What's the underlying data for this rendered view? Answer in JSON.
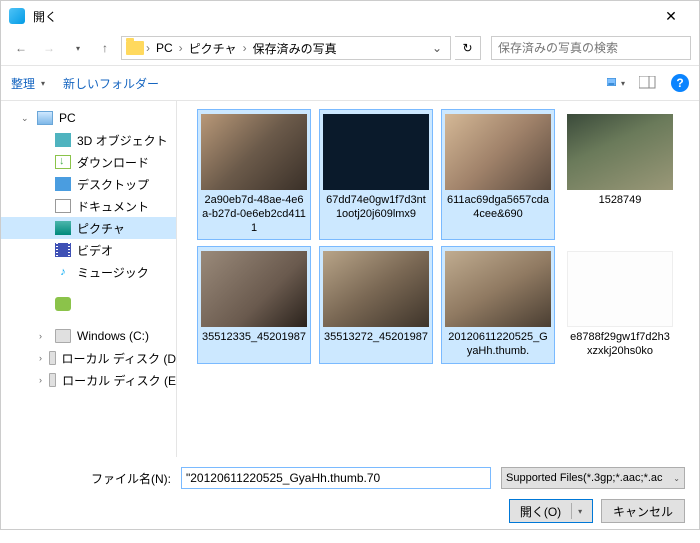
{
  "window": {
    "title": "開く"
  },
  "nav": {
    "crumbs": [
      "PC",
      "ピクチャ",
      "保存済みの写真"
    ],
    "search_placeholder": "保存済みの写真の検索"
  },
  "toolbar": {
    "organize": "整理",
    "new_folder": "新しいフォルダー"
  },
  "sidebar": {
    "items": [
      {
        "label": "PC",
        "icon": "pc",
        "lvl": 1,
        "expanded": true
      },
      {
        "label": "3D オブジェクト",
        "icon": "3d",
        "lvl": 2
      },
      {
        "label": "ダウンロード",
        "icon": "dl",
        "lvl": 2
      },
      {
        "label": "デスクトップ",
        "icon": "desk",
        "lvl": 2
      },
      {
        "label": "ドキュメント",
        "icon": "doc",
        "lvl": 2
      },
      {
        "label": "ピクチャ",
        "icon": "pic",
        "lvl": 2,
        "selected": true
      },
      {
        "label": "ビデオ",
        "icon": "vid",
        "lvl": 2
      },
      {
        "label": "ミュージック",
        "icon": "mus",
        "lvl": 2
      },
      {
        "label": "",
        "icon": "app",
        "lvl": 2,
        "app": true
      },
      {
        "label": "Windows (C:)",
        "icon": "drv",
        "lvl": 2
      },
      {
        "label": "ローカル ディスク (D",
        "icon": "drv",
        "lvl": 2
      },
      {
        "label": "ローカル ディスク (E",
        "icon": "drv",
        "lvl": 2
      }
    ]
  },
  "files": [
    {
      "name": "2a90eb7d-48ae-4e6a-b27d-0e6eb2cd4111",
      "thumb": "face1",
      "sel": true
    },
    {
      "name": "67dd74e0gw1f7d3nt1ootj20j609lmx9",
      "thumb": "dark",
      "sel": true
    },
    {
      "name": "611ac69dga5657cda4cee&690",
      "thumb": "face3",
      "sel": true
    },
    {
      "name": "1528749",
      "thumb": "face4",
      "sel": false
    },
    {
      "name": "35512335_45201987",
      "thumb": "face5",
      "sel": true
    },
    {
      "name": "35513272_45201987",
      "thumb": "face6",
      "sel": true
    },
    {
      "name": "20120611220525_GyaHh.thumb.",
      "thumb": "face7",
      "sel": true
    },
    {
      "name": "e8788f29gw1f7d2h3xzxkj20hs0ko",
      "thumb": "note",
      "sel": false
    }
  ],
  "footer": {
    "filename_label": "ファイル名(N):",
    "filename_value": "\"20120611220525_GyaHh.thumb.70",
    "filter": "Supported Files(*.3gp;*.aac;*.ac",
    "open": "開く(O)",
    "cancel": "キャンセル"
  }
}
